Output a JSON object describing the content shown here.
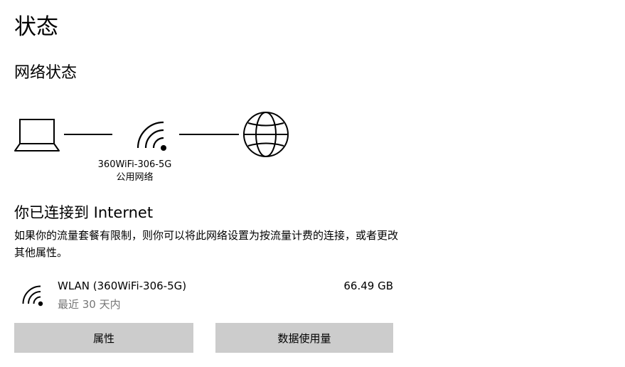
{
  "page": {
    "title": "状态"
  },
  "network_status": {
    "section_title": "网络状态",
    "network_name": "360WiFi-306-5G",
    "network_type": "公用网络",
    "icons": [
      "laptop-icon",
      "wifi-icon",
      "globe-icon"
    ]
  },
  "connection": {
    "heading": "你已连接到 Internet",
    "description": "如果你的流量套餐有限制，则你可以将此网络设置为按流量计费的连接，或者更改其他属性。"
  },
  "adapter": {
    "icon": "wifi-icon",
    "name": "WLAN (360WiFi-306-5G)",
    "period": "最近 30 天内",
    "usage": "66.49 GB"
  },
  "buttons": {
    "properties_label": "属性",
    "data_usage_label": "数据使用量"
  }
}
